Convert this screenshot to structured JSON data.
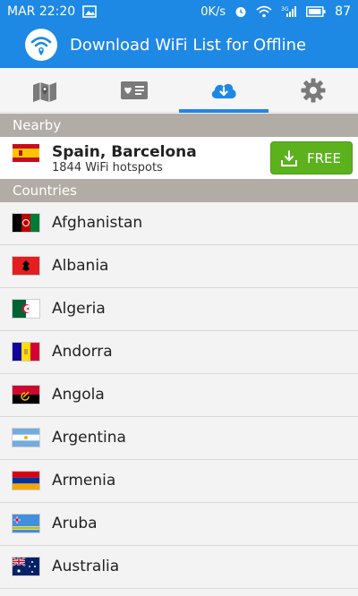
{
  "status_bar": {
    "time": "MAR 22:20",
    "data_rate": "0K/s",
    "battery": "87",
    "network": "3G"
  },
  "app_bar": {
    "title": "Download WiFi List for Offline",
    "logo_icon": "wifi-location-icon"
  },
  "tabs": [
    {
      "icon": "map-icon",
      "active": false
    },
    {
      "icon": "favorites-card-icon",
      "active": false
    },
    {
      "icon": "cloud-download-icon",
      "active": true
    },
    {
      "icon": "gear-icon",
      "active": false
    }
  ],
  "nearby": {
    "header": "Nearby",
    "name": "Spain, Barcelona",
    "subtitle": "1844 WiFi hotspots",
    "button_label": "FREE"
  },
  "countries": {
    "header": "Countries",
    "items": [
      {
        "name": "Afghanistan"
      },
      {
        "name": "Albania"
      },
      {
        "name": "Algeria"
      },
      {
        "name": "Andorra"
      },
      {
        "name": "Angola"
      },
      {
        "name": "Argentina"
      },
      {
        "name": "Armenia"
      },
      {
        "name": "Aruba"
      },
      {
        "name": "Australia"
      }
    ]
  },
  "colors": {
    "primary": "#1e88e5",
    "section_header": "#b2aca6",
    "free_button": "#5cb21d"
  }
}
